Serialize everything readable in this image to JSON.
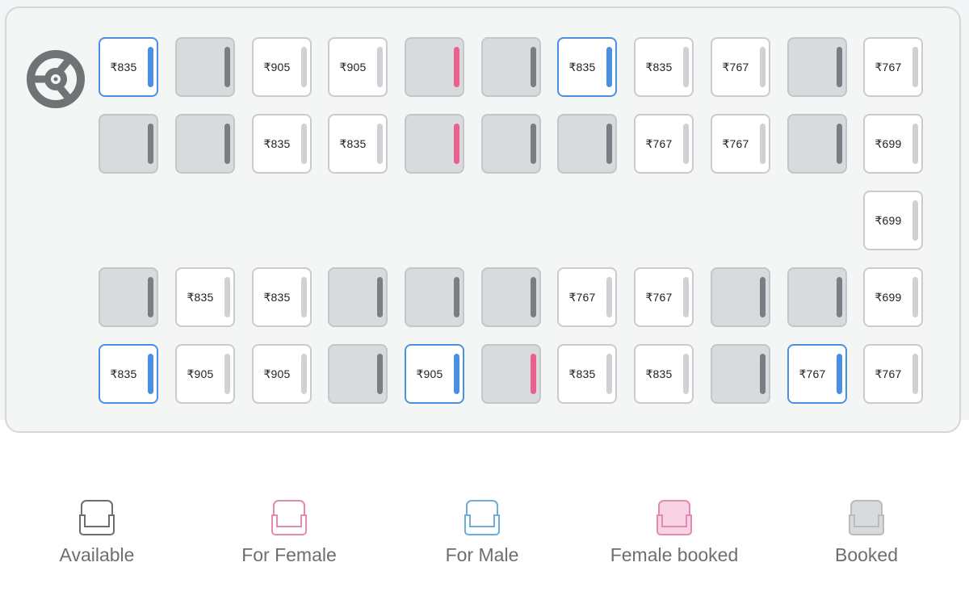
{
  "legend": [
    {
      "key": "available",
      "label": "Available",
      "stroke": "#6b6e73",
      "fill": "#ffffff"
    },
    {
      "key": "female",
      "label": "For Female",
      "stroke": "#e48ab0",
      "fill": "#ffffff"
    },
    {
      "key": "male",
      "label": "For Male",
      "stroke": "#6aaee0",
      "fill": "#ffffff"
    },
    {
      "key": "female-booked",
      "label": "Female booked",
      "stroke": "#e48ab0",
      "fill": "#f7d3e3"
    },
    {
      "key": "booked",
      "label": "Booked",
      "stroke": "#b9bbbf",
      "fill": "#d9dadd"
    }
  ],
  "seat_rows": [
    [
      {
        "status": "male",
        "price": "₹835"
      },
      {
        "status": "booked",
        "price": ""
      },
      {
        "status": "available",
        "price": "₹905"
      },
      {
        "status": "available",
        "price": "₹905"
      },
      {
        "status": "female-booked",
        "price": ""
      },
      {
        "status": "booked",
        "price": ""
      },
      {
        "status": "male",
        "price": "₹835"
      },
      {
        "status": "available",
        "price": "₹835"
      },
      {
        "status": "available",
        "price": "₹767"
      },
      {
        "status": "booked",
        "price": ""
      },
      {
        "status": "available",
        "price": "₹767"
      }
    ],
    [
      {
        "status": "booked",
        "price": ""
      },
      {
        "status": "booked",
        "price": ""
      },
      {
        "status": "available",
        "price": "₹835"
      },
      {
        "status": "available",
        "price": "₹835"
      },
      {
        "status": "female-booked",
        "price": ""
      },
      {
        "status": "booked",
        "price": ""
      },
      {
        "status": "booked",
        "price": ""
      },
      {
        "status": "available",
        "price": "₹767"
      },
      {
        "status": "available",
        "price": "₹767"
      },
      {
        "status": "booked",
        "price": ""
      },
      {
        "status": "available",
        "price": "₹699"
      }
    ],
    [
      null,
      null,
      null,
      null,
      null,
      null,
      null,
      null,
      null,
      null,
      {
        "status": "available",
        "price": "₹699"
      }
    ],
    [
      {
        "status": "booked",
        "price": ""
      },
      {
        "status": "available",
        "price": "₹835"
      },
      {
        "status": "available",
        "price": "₹835"
      },
      {
        "status": "booked",
        "price": ""
      },
      {
        "status": "booked",
        "price": ""
      },
      {
        "status": "booked",
        "price": ""
      },
      {
        "status": "available",
        "price": "₹767"
      },
      {
        "status": "available",
        "price": "₹767"
      },
      {
        "status": "booked",
        "price": ""
      },
      {
        "status": "booked",
        "price": ""
      },
      {
        "status": "available",
        "price": "₹699"
      }
    ],
    [
      {
        "status": "male",
        "price": "₹835"
      },
      {
        "status": "available",
        "price": "₹905"
      },
      {
        "status": "available",
        "price": "₹905"
      },
      {
        "status": "booked",
        "price": ""
      },
      {
        "status": "male",
        "price": "₹905"
      },
      {
        "status": "female-booked",
        "price": ""
      },
      {
        "status": "available",
        "price": "₹835"
      },
      {
        "status": "available",
        "price": "₹835"
      },
      {
        "status": "booked",
        "price": ""
      },
      {
        "status": "male",
        "price": "₹767"
      },
      {
        "status": "available",
        "price": "₹767"
      }
    ]
  ]
}
